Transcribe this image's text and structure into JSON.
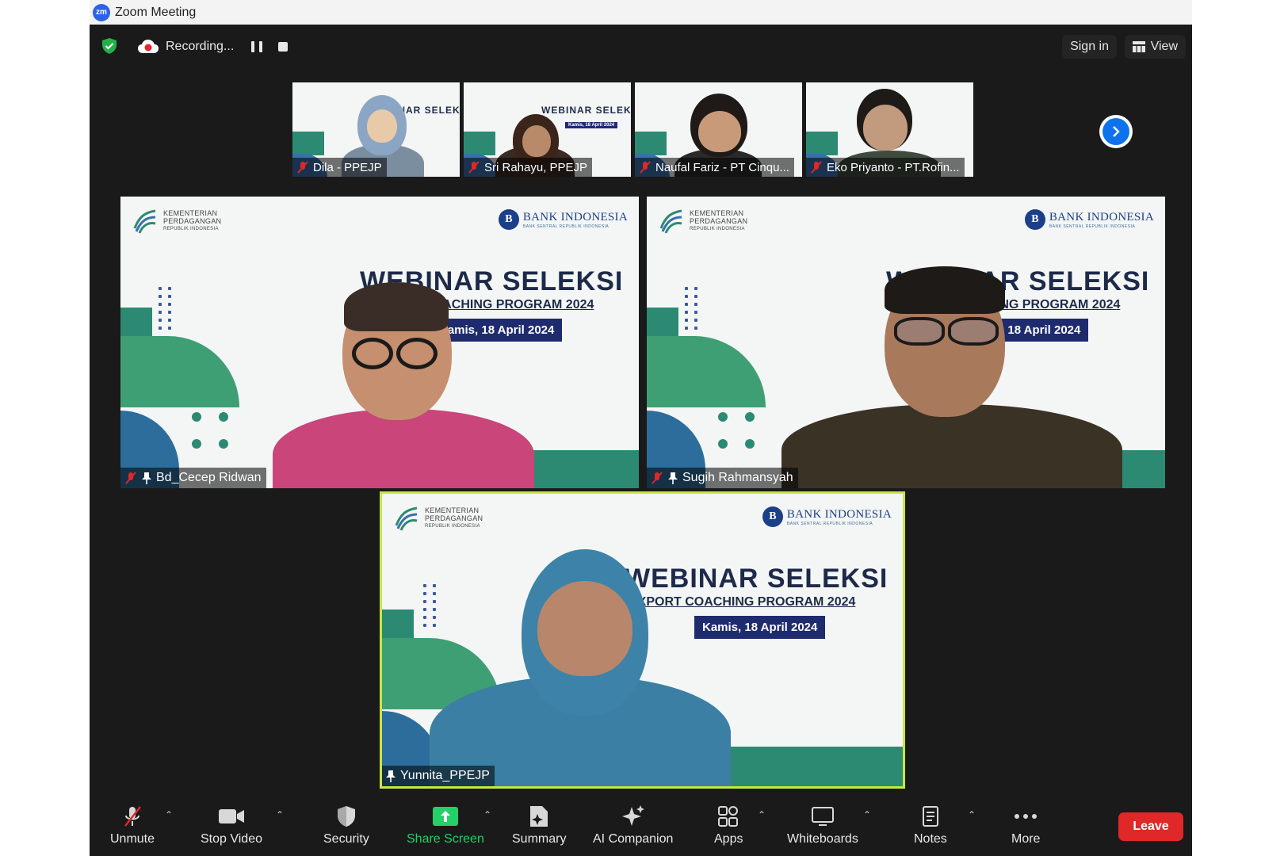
{
  "window": {
    "title": "Zoom Meeting",
    "logo": "zm"
  },
  "topbar": {
    "recording_label": "Recording...",
    "sign_in": "Sign in",
    "view": "View"
  },
  "slide": {
    "ministry": [
      "KEMENTERIAN",
      "PERDAGANGAN",
      "REPUBLIK INDONESIA"
    ],
    "bank": "BANK INDONESIA",
    "bank_sub": "BANK SENTRAL REPUBLIK INDONESIA",
    "title": "WEBINAR SELEKSI",
    "subtitle": "EXPORT COACHING PROGRAM 2024",
    "date": "Kamis, 18 April 2024"
  },
  "thumbnails": [
    {
      "name": "Dila - PPEJP",
      "muted": true
    },
    {
      "name": "Sri Rahayu, PPEJP",
      "muted": true
    },
    {
      "name": "Naufal Fariz - PT Cinqu...",
      "muted": true
    },
    {
      "name": "Eko Priyanto - PT.Rofin...",
      "muted": true
    }
  ],
  "tiles": [
    {
      "name": "Bd_Cecep Ridwan",
      "muted": true,
      "pinned": true
    },
    {
      "name": "Sugih Rahmansyah",
      "muted": true,
      "pinned": true
    },
    {
      "name": "Yunnita_PPEJP",
      "muted": false,
      "pinned": true,
      "active": true
    }
  ],
  "toolbar": {
    "unmute": "Unmute",
    "stop_video": "Stop Video",
    "security": "Security",
    "share_screen": "Share Screen",
    "summary": "Summary",
    "ai_companion": "AI Companion",
    "apps": "Apps",
    "whiteboards": "Whiteboards",
    "notes": "Notes",
    "more": "More",
    "leave": "Leave"
  },
  "colors": {
    "share_green": "#24d068",
    "leave_red": "#e02828",
    "active_speaker": "#c9e646",
    "accent_blue": "#0e72ed"
  }
}
